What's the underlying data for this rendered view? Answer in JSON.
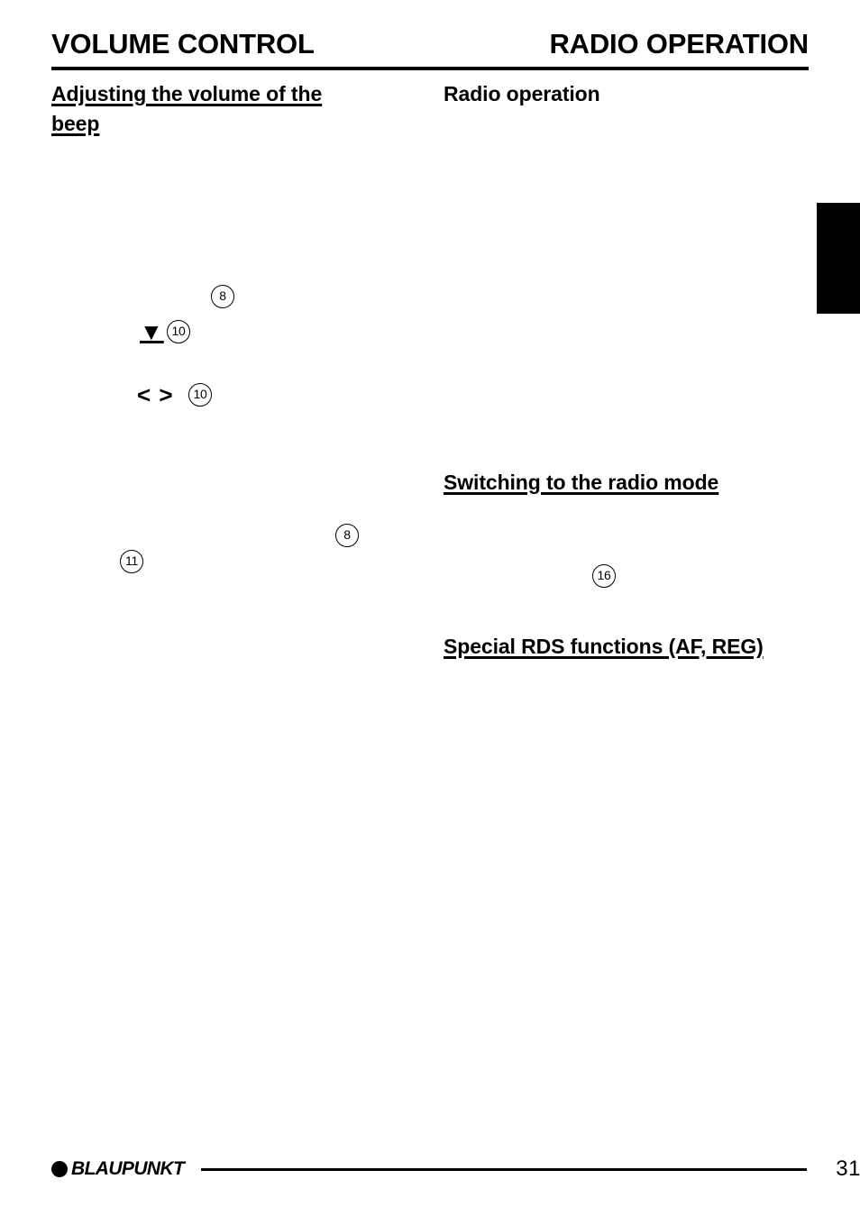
{
  "document": {
    "page_number": "31",
    "brand": "BLAUPUNKT"
  },
  "header": {
    "left_title": "VOLUME CONTROL",
    "right_title": "RADIO OPERATION"
  },
  "left_column": {
    "heading": "Adjusting the volume of the beep",
    "callouts": [
      {
        "id": "callout-8-upper",
        "label": "8"
      },
      {
        "id": "callout-10-volume",
        "label": "10"
      },
      {
        "id": "callout-10-arrows",
        "label": "10"
      },
      {
        "id": "callout-8-lower",
        "label": "8"
      },
      {
        "id": "callout-11",
        "label": "11"
      }
    ],
    "symbols": [
      {
        "id": "volume-down-symbol",
        "glyph": "▼"
      },
      {
        "id": "left-right-arrows-symbol",
        "glyph": "< >"
      }
    ]
  },
  "right_column": {
    "heading_main": "Radio operation",
    "heading_switching": "Switching to the radio mode",
    "heading_rds": "Special RDS functions (AF, REG)",
    "callouts": [
      {
        "id": "callout-16",
        "label": "16"
      }
    ]
  }
}
